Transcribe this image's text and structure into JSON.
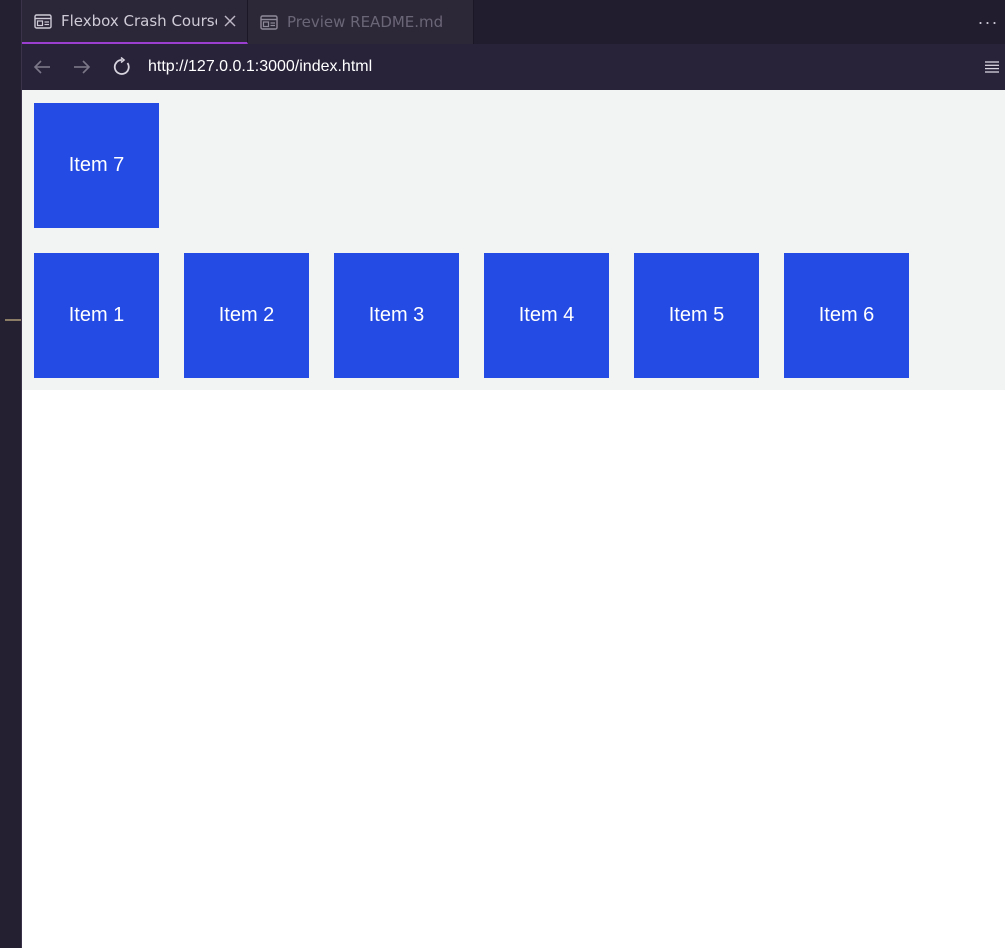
{
  "tabs": [
    {
      "label": "Flexbox Crash Course",
      "active": true,
      "icon": "preview-icon"
    },
    {
      "label": "Preview README.md",
      "active": false,
      "icon": "preview-icon"
    }
  ],
  "tabbar": {
    "more": "···"
  },
  "address": {
    "url": "http://127.0.0.1:3000/index.html"
  },
  "content": {
    "top_row": [
      "Item 7"
    ],
    "bottom_row": [
      "Item 1",
      "Item 2",
      "Item 3",
      "Item 4",
      "Item 5",
      "Item 6"
    ]
  },
  "colors": {
    "item_bg": "#244be3",
    "container_bg": "#f2f4f3",
    "active_tab_border": "#9a3fd0"
  }
}
